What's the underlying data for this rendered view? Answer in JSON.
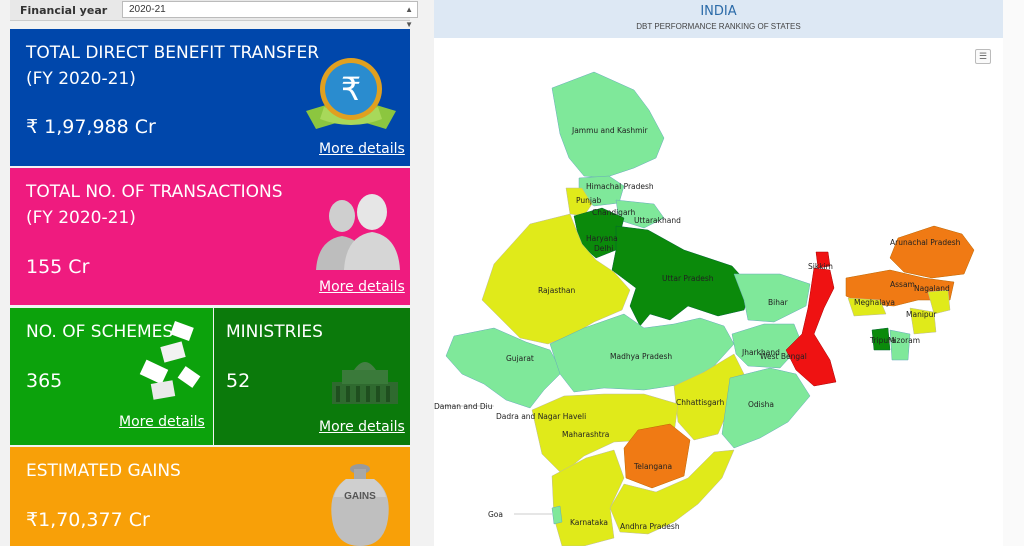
{
  "filter": {
    "label": "Financial year",
    "value": "2020-21"
  },
  "tiles": {
    "dbt": {
      "title1": "TOTAL DIRECT BENEFIT TRANSFER",
      "title2": "(FY 2020-21)",
      "value": "₹ 1,97,988 Cr",
      "link": "More details",
      "icon": "rupee-medal-icon"
    },
    "transactions": {
      "title1": "TOTAL NO. OF TRANSACTIONS",
      "title2": "(FY 2020-21)",
      "value": "155 Cr",
      "link": "More details",
      "icon": "people-icon"
    },
    "schemes": {
      "title": "NO. OF SCHEMES",
      "value": "365",
      "link": "More details",
      "icon": "papers-icon"
    },
    "ministries": {
      "title": "MINISTRIES",
      "value": "52",
      "link": "More details",
      "icon": "parliament-icon"
    },
    "gains": {
      "title": "ESTIMATED GAINS",
      "value": "₹1,70,377 Cr",
      "badge": "GAINS",
      "icon": "gains-pot-icon"
    }
  },
  "map": {
    "title": "INDIA",
    "subtitle": "DBT PERFORMANCE RANKING OF STATES",
    "colors": {
      "dark_green": "#0b8a0b",
      "light_green": "#7fe89a",
      "yellow": "#e0ea1a",
      "orange": "#f07a14",
      "red": "#ef1212"
    },
    "states": [
      "Jammu and Kashmir",
      "Himachal Pradesh",
      "Punjab",
      "Chandigarh",
      "Uttarakhand",
      "Haryana",
      "Delhi",
      "Uttar Pradesh",
      "Rajasthan",
      "Sikkim",
      "Arunachal Pradesh",
      "Assam",
      "Nagaland",
      "Meghalaya",
      "Manipur",
      "Bihar",
      "Gujarat",
      "Madhya Pradesh",
      "Jharkhand",
      "West Bengal",
      "Tripura",
      "Mizoram",
      "Daman and Diu",
      "Dadra and Nagar Haveli",
      "Chhattisgarh",
      "Odisha",
      "Maharashtra",
      "Telangana",
      "Goa",
      "Karnataka",
      "Andhra Pradesh"
    ]
  }
}
